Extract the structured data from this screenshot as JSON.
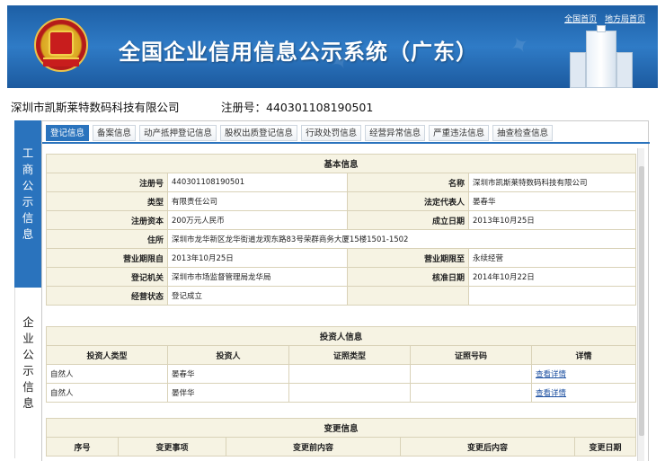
{
  "header": {
    "title": "全国企业信用信息公示系统（广东）",
    "links": [
      "全国首页",
      "地方局首页"
    ]
  },
  "company": {
    "name": "深圳市凯斯莱特数码科技有限公司",
    "reg_label": "注册号：",
    "reg_no": "440301108190501"
  },
  "side_tabs": [
    "工商公示信息",
    "企业公示信息"
  ],
  "tabs": [
    "登记信息",
    "备案信息",
    "动产抵押登记信息",
    "股权出质登记信息",
    "行政处罚信息",
    "经营异常信息",
    "严重违法信息",
    "抽查检查信息"
  ],
  "basic": {
    "caption": "基本信息",
    "rows": [
      {
        "l1": "注册号",
        "v1": "440301108190501",
        "l2": "名称",
        "v2": "深圳市凯斯莱特数码科技有限公司"
      },
      {
        "l1": "类型",
        "v1": "有限责任公司",
        "l2": "法定代表人",
        "v2": "晏春华"
      },
      {
        "l1": "注册资本",
        "v1": "200万元人民币",
        "l2": "成立日期",
        "v2": "2013年10月25日"
      },
      {
        "l1": "住所",
        "v1": "深圳市龙华新区龙华街道龙观东路83号荣群商务大厦15楼1501-1502"
      },
      {
        "l1": "营业期限自",
        "v1": "2013年10月25日",
        "l2": "营业期限至",
        "v2": "永续经营"
      },
      {
        "l1": "登记机关",
        "v1": "深圳市市场监督管理局龙华局",
        "l2": "核准日期",
        "v2": "2014年10月22日"
      },
      {
        "l1": "经营状态",
        "v1": "登记成立",
        "l2": "",
        "v2": ""
      }
    ]
  },
  "investors": {
    "caption": "投资人信息",
    "headers": [
      "投资人类型",
      "投资人",
      "证照类型",
      "证照号码",
      "详情"
    ],
    "rows": [
      {
        "type": "自然人",
        "name": "晏春华",
        "id_type": "",
        "id_no": "",
        "detail": "查看详情"
      },
      {
        "type": "自然人",
        "name": "晏伴华",
        "id_type": "",
        "id_no": "",
        "detail": "查看详情"
      }
    ]
  },
  "changes": {
    "caption": "变更信息",
    "headers": [
      "序号",
      "变更事项",
      "变更前内容",
      "变更后内容",
      "变更日期"
    ]
  }
}
